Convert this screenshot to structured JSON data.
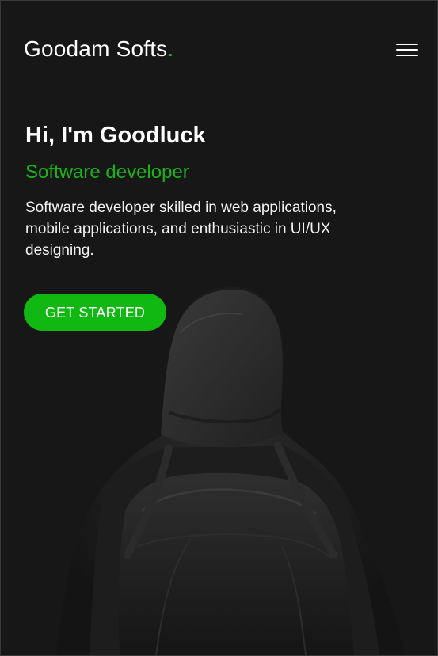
{
  "brand": {
    "name": "Goodam Softs",
    "dot": "."
  },
  "navigation": {
    "menu_icon": "hamburger-menu-icon"
  },
  "hero": {
    "headline": "Hi, I'm Goodluck",
    "subtitle": "Software developer",
    "description": "Software developer skilled in web applications, mobile applications, and enthusiastic in UI/UX designing.",
    "cta_label": "GET STARTED",
    "image": "hooded-person-with-backpack"
  },
  "colors": {
    "background": "#171717",
    "accent": "#12b812",
    "text": "#ffffff"
  }
}
